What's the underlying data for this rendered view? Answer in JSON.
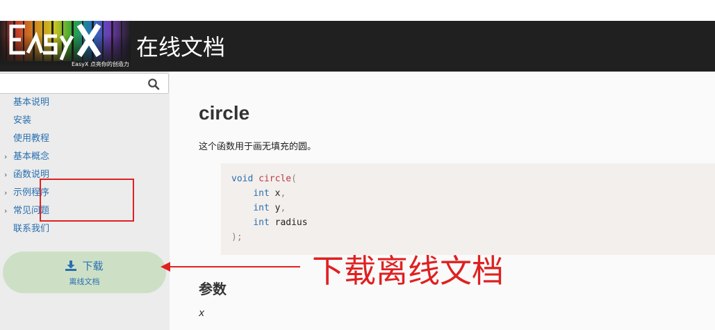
{
  "header": {
    "logo_text": "EasyX",
    "logo_tagline": "EasyX 点亮你的创造力",
    "site_title": "在线文档"
  },
  "sidebar": {
    "search": {
      "placeholder": "",
      "value": ""
    },
    "items": [
      {
        "label": "基本说明",
        "expandable": false
      },
      {
        "label": "安装",
        "expandable": false
      },
      {
        "label": "使用教程",
        "expandable": false
      },
      {
        "label": "基本概念",
        "expandable": true
      },
      {
        "label": "函数说明",
        "expandable": true
      },
      {
        "label": "示例程序",
        "expandable": true
      },
      {
        "label": "常见问题",
        "expandable": true
      },
      {
        "label": "联系我们",
        "expandable": false
      }
    ],
    "download": {
      "label": "下载",
      "sublabel": "离线文档"
    }
  },
  "content": {
    "title": "circle",
    "description": "这个函数用于画无填充的圆。",
    "code": {
      "return_type": "void",
      "function_name": "circle",
      "open_paren": "(",
      "params": [
        {
          "type": "int",
          "name": "x",
          "sep": ","
        },
        {
          "type": "int",
          "name": "y",
          "sep": ","
        },
        {
          "type": "int",
          "name": "radius",
          "sep": ""
        }
      ],
      "close": ");"
    },
    "section_title": "参数",
    "first_param": "x"
  },
  "annotation": {
    "text": "下载离线文档",
    "color": "#e02020"
  },
  "colors": {
    "header_bg": "#202020",
    "sidebar_bg": "#ececec",
    "link": "#2a6fb0",
    "download_bg": "#cde0c6",
    "code_bg": "#f3efec",
    "code_keyword": "#2a6fb0",
    "code_function": "#b83a4b"
  }
}
